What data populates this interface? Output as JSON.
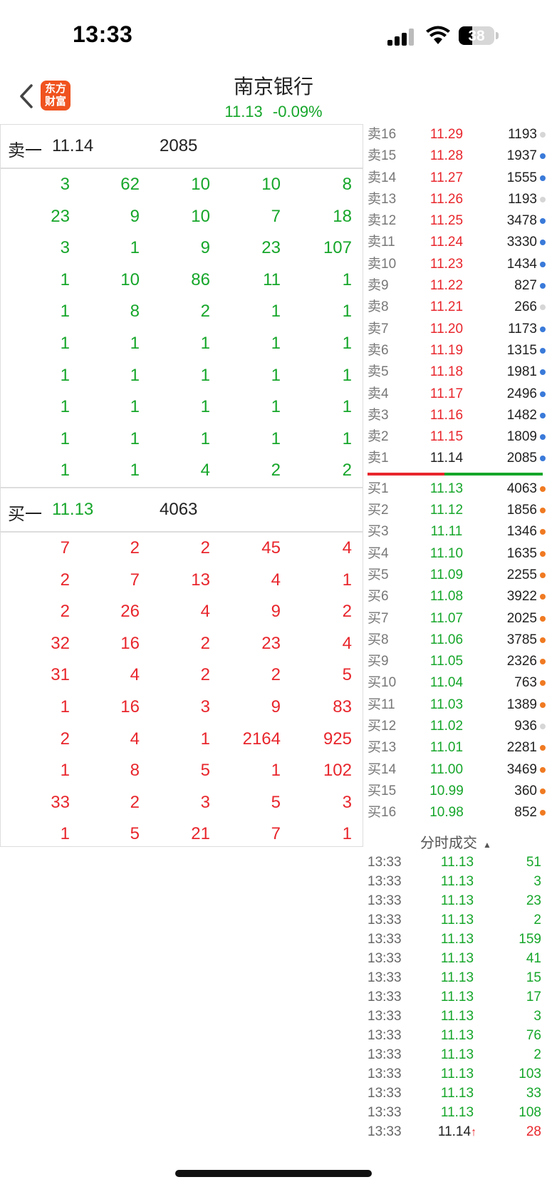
{
  "status_bar": {
    "time": "13:33",
    "battery": "38",
    "battery_level": 0.38
  },
  "header": {
    "title": "南京银行",
    "price": "11.13",
    "change": "-0.09%",
    "logo_line1": "东方",
    "logo_line2": "财富"
  },
  "colors": {
    "up": "#e8262c",
    "down": "#16a62a",
    "accent": "#f0531f"
  },
  "sell_one": {
    "label": "卖一",
    "price": "11.14",
    "volume": "2085",
    "grid": [
      [
        "3",
        "62",
        "10",
        "10",
        "8"
      ],
      [
        "23",
        "9",
        "10",
        "7",
        "18"
      ],
      [
        "3",
        "1",
        "9",
        "23",
        "107"
      ],
      [
        "1",
        "10",
        "86",
        "11",
        "1"
      ],
      [
        "1",
        "8",
        "2",
        "1",
        "1"
      ],
      [
        "1",
        "1",
        "1",
        "1",
        "1"
      ],
      [
        "1",
        "1",
        "1",
        "1",
        "1"
      ],
      [
        "1",
        "1",
        "1",
        "1",
        "1"
      ],
      [
        "1",
        "1",
        "1",
        "1",
        "1"
      ],
      [
        "1",
        "1",
        "4",
        "2",
        "2"
      ]
    ]
  },
  "buy_one": {
    "label": "买一",
    "price": "11.13",
    "volume": "4063",
    "grid": [
      [
        "7",
        "2",
        "2",
        "45",
        "4"
      ],
      [
        "2",
        "7",
        "13",
        "4",
        "1"
      ],
      [
        "2",
        "26",
        "4",
        "9",
        "2"
      ],
      [
        "32",
        "16",
        "2",
        "23",
        "4"
      ],
      [
        "31",
        "4",
        "2",
        "2",
        "5"
      ],
      [
        "1",
        "16",
        "3",
        "9",
        "83"
      ],
      [
        "2",
        "4",
        "1",
        "2164",
        "925"
      ],
      [
        "1",
        "8",
        "5",
        "1",
        "102"
      ],
      [
        "33",
        "2",
        "3",
        "5",
        "3"
      ],
      [
        "1",
        "5",
        "21",
        "7",
        "1"
      ]
    ]
  },
  "asks": [
    {
      "label": "卖16",
      "price": "11.29",
      "volume": "1193",
      "dot": "light"
    },
    {
      "label": "卖15",
      "price": "11.28",
      "volume": "1937",
      "dot": "blue"
    },
    {
      "label": "卖14",
      "price": "11.27",
      "volume": "1555",
      "dot": "blue"
    },
    {
      "label": "卖13",
      "price": "11.26",
      "volume": "1193",
      "dot": "light"
    },
    {
      "label": "卖12",
      "price": "11.25",
      "volume": "3478",
      "dot": "blue"
    },
    {
      "label": "卖11",
      "price": "11.24",
      "volume": "3330",
      "dot": "blue"
    },
    {
      "label": "卖10",
      "price": "11.23",
      "volume": "1434",
      "dot": "blue"
    },
    {
      "label": "卖9",
      "price": "11.22",
      "volume": "827",
      "dot": "blue"
    },
    {
      "label": "卖8",
      "price": "11.21",
      "volume": "266",
      "dot": "light"
    },
    {
      "label": "卖7",
      "price": "11.20",
      "volume": "1173",
      "dot": "blue"
    },
    {
      "label": "卖6",
      "price": "11.19",
      "volume": "1315",
      "dot": "blue"
    },
    {
      "label": "卖5",
      "price": "11.18",
      "volume": "1981",
      "dot": "blue"
    },
    {
      "label": "卖4",
      "price": "11.17",
      "volume": "2496",
      "dot": "blue"
    },
    {
      "label": "卖3",
      "price": "11.16",
      "volume": "1482",
      "dot": "blue"
    },
    {
      "label": "卖2",
      "price": "11.15",
      "volume": "1809",
      "dot": "blue"
    },
    {
      "label": "卖1",
      "price": "11.14",
      "volume": "2085",
      "dot": "blue"
    }
  ],
  "bids": [
    {
      "label": "买1",
      "price": "11.13",
      "volume": "4063",
      "dot": "orange"
    },
    {
      "label": "买2",
      "price": "11.12",
      "volume": "1856",
      "dot": "orange"
    },
    {
      "label": "买3",
      "price": "11.11",
      "volume": "1346",
      "dot": "orange"
    },
    {
      "label": "买4",
      "price": "11.10",
      "volume": "1635",
      "dot": "orange"
    },
    {
      "label": "买5",
      "price": "11.09",
      "volume": "2255",
      "dot": "orange"
    },
    {
      "label": "买6",
      "price": "11.08",
      "volume": "3922",
      "dot": "orange"
    },
    {
      "label": "买7",
      "price": "11.07",
      "volume": "2025",
      "dot": "orange"
    },
    {
      "label": "买8",
      "price": "11.06",
      "volume": "3785",
      "dot": "orange"
    },
    {
      "label": "买9",
      "price": "11.05",
      "volume": "2326",
      "dot": "orange"
    },
    {
      "label": "买10",
      "price": "11.04",
      "volume": "763",
      "dot": "orange"
    },
    {
      "label": "买11",
      "price": "11.03",
      "volume": "1389",
      "dot": "orange"
    },
    {
      "label": "买12",
      "price": "11.02",
      "volume": "936",
      "dot": "light"
    },
    {
      "label": "买13",
      "price": "11.01",
      "volume": "2281",
      "dot": "orange"
    },
    {
      "label": "买14",
      "price": "11.00",
      "volume": "3469",
      "dot": "orange"
    },
    {
      "label": "买15",
      "price": "10.99",
      "volume": "360",
      "dot": "orange"
    },
    {
      "label": "买16",
      "price": "10.98",
      "volume": "852",
      "dot": "orange"
    }
  ],
  "trades_header": "分时成交",
  "trades": [
    {
      "time": "13:33",
      "price": "11.13",
      "volume": "51",
      "dir": "down"
    },
    {
      "time": "13:33",
      "price": "11.13",
      "volume": "3",
      "dir": "down"
    },
    {
      "time": "13:33",
      "price": "11.13",
      "volume": "23",
      "dir": "down"
    },
    {
      "time": "13:33",
      "price": "11.13",
      "volume": "2",
      "dir": "down"
    },
    {
      "time": "13:33",
      "price": "11.13",
      "volume": "159",
      "dir": "down"
    },
    {
      "time": "13:33",
      "price": "11.13",
      "volume": "41",
      "dir": "down"
    },
    {
      "time": "13:33",
      "price": "11.13",
      "volume": "15",
      "dir": "down"
    },
    {
      "time": "13:33",
      "price": "11.13",
      "volume": "17",
      "dir": "down"
    },
    {
      "time": "13:33",
      "price": "11.13",
      "volume": "3",
      "dir": "down"
    },
    {
      "time": "13:33",
      "price": "11.13",
      "volume": "76",
      "dir": "down"
    },
    {
      "time": "13:33",
      "price": "11.13",
      "volume": "2",
      "dir": "down"
    },
    {
      "time": "13:33",
      "price": "11.13",
      "volume": "103",
      "dir": "down"
    },
    {
      "time": "13:33",
      "price": "11.13",
      "volume": "33",
      "dir": "down"
    },
    {
      "time": "13:33",
      "price": "11.13",
      "volume": "108",
      "dir": "down"
    },
    {
      "time": "13:33",
      "price": "11.14",
      "volume": "28",
      "dir": "up",
      "arrow": "↑"
    }
  ]
}
